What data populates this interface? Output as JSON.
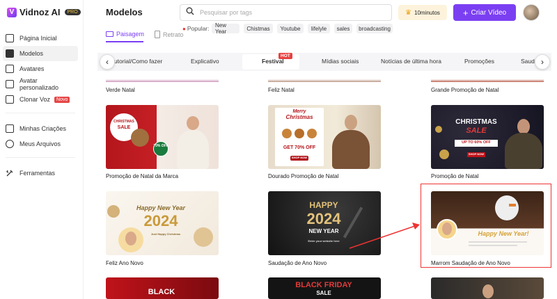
{
  "app": {
    "brand": "Vidnoz AI",
    "pro_badge": "PRO"
  },
  "sidebar": {
    "items": [
      {
        "label": "Página Inicial",
        "icon": "home-icon"
      },
      {
        "label": "Modelos",
        "icon": "templates-icon",
        "active": true
      },
      {
        "label": "Avatares",
        "icon": "avatar-icon"
      },
      {
        "label": "Avatar personalizado",
        "icon": "custom-avatar-icon"
      },
      {
        "label": "Clonar Voz",
        "icon": "voice-icon",
        "badge": "Novo"
      },
      {
        "label": "Minhas Criações",
        "icon": "play-icon"
      },
      {
        "label": "Meus Arquivos",
        "icon": "cloud-icon"
      },
      {
        "label": "Ferramentas",
        "icon": "tools-icon"
      }
    ]
  },
  "header": {
    "title": "Modelos",
    "search_placeholder": "Pesquisar por tags",
    "minutes": "10minutos",
    "create_label": "Criar Vídeo"
  },
  "modes": {
    "landscape": "Paisagem",
    "portrait": "Retrato"
  },
  "popular": {
    "label": "Popular:",
    "tags": [
      "New Year",
      "Chistmas",
      "Youtube",
      "lifelyle",
      "sales",
      "broadcasting"
    ]
  },
  "categories": [
    "Tutorial/Como fazer",
    "Explicativo",
    "Festival",
    "Mídias sociais",
    "Notícias de última hora",
    "Promoções",
    "Saudação"
  ],
  "hot_badge": "HOT",
  "top_captions": [
    "Verde Natal",
    "Feliz Natal",
    "Grande Promoção de Natal"
  ],
  "row1": {
    "captions": [
      "Promoção de Natal da Marca",
      "Dourado Promoção de Natal",
      "Promoção de Natal"
    ],
    "t1": {
      "line1": "CHRISTMAS",
      "line2": "SALE",
      "badge": "70% OFF"
    },
    "t2": {
      "line1": "Merry",
      "line2": "Christmas",
      "offer": "GET 70% OFF",
      "btn": "SHOP NOW"
    },
    "t3": {
      "line1": "CHRISTMAS",
      "line2": "SALE",
      "offer": "UP TO 60% OFF",
      "btn": "SHOP NOW"
    }
  },
  "row2": {
    "captions": [
      "Feliz Ano Novo",
      "Saudação de Ano Novo",
      "Marrom Saudação de Ano Novo"
    ],
    "t1": {
      "line1": "Happy New Year",
      "year": "2024",
      "sub": "Just Happy Christmas"
    },
    "t2": {
      "line1": "HAPPY",
      "year": "2024",
      "line3": "NEW YEAR",
      "sub": "Enter your website here"
    },
    "t3": {
      "line1": "Happy New Year!"
    }
  },
  "row3": {
    "t2": {
      "line1": "BLACK FRIDAY",
      "line2": "SALE"
    },
    "t1": {
      "line1": "BLACK"
    }
  },
  "colors": {
    "accent": "#7b3ff2",
    "highlight": "#e33333"
  }
}
